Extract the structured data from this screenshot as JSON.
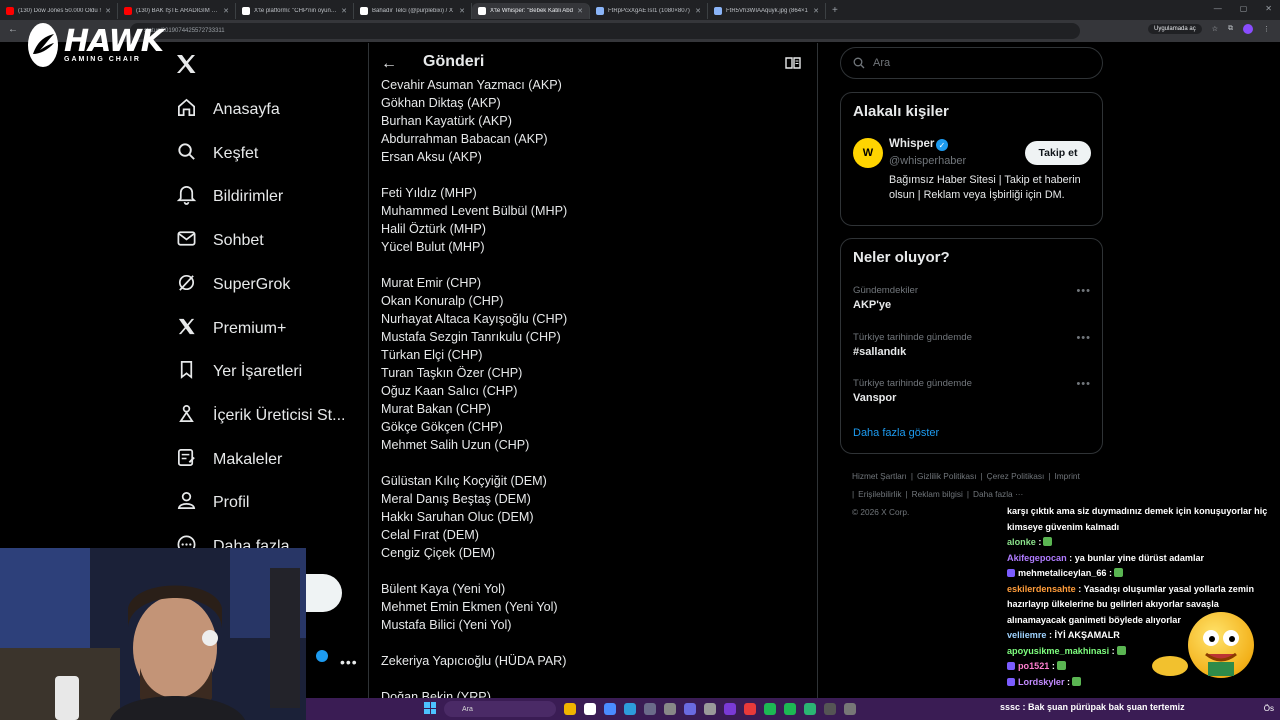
{
  "browser": {
    "tabs": [
      {
        "label": "(130) Dow Jones 50.000 Oldu !",
        "color": "#ff0000"
      },
      {
        "label": "(130) BAK İŞTE ARADIĞIM OYUN",
        "color": "#ff0000"
      },
      {
        "label": "X'te platformi: \"CHP'nin oyunlar",
        "color": "#ffffff"
      },
      {
        "label": "Bahadır Telci (@purplebixi) / X",
        "color": "#ffffff"
      },
      {
        "label": "X'te Whisper: \"Bebek Katili Abd",
        "color": "#ffffff",
        "active": true
      },
      {
        "label": "FtRpPcxXgAETsI1 (1080×807)",
        "color": "#8ab4f8"
      },
      {
        "label": "FtR5Vh3WIAAquyk.jpg (864×1",
        "color": "#8ab4f8"
      }
    ],
    "address": "status/2019074425572733311",
    "open_in_app": "Uygulamada aç"
  },
  "overlay": {
    "brand": "HAWK",
    "brand_sub": "GAMING CHAIR"
  },
  "nav": {
    "items": [
      {
        "label": "Anasayfa",
        "icon": "home-icon"
      },
      {
        "label": "Keşfet",
        "icon": "search-icon"
      },
      {
        "label": "Bildirimler",
        "icon": "bell-icon"
      },
      {
        "label": "Sohbet",
        "icon": "mail-icon"
      },
      {
        "label": "SuperGrok",
        "icon": "grok-icon"
      },
      {
        "label": "Premium+",
        "icon": "x-icon"
      },
      {
        "label": "Yer İşaretleri",
        "icon": "bookmark-icon"
      },
      {
        "label": "İçerik Üreticisi St...",
        "icon": "creator-icon"
      },
      {
        "label": "Makaleler",
        "icon": "article-icon"
      },
      {
        "label": "Profil",
        "icon": "person-icon"
      },
      {
        "label": "Daha fazla",
        "icon": "more-icon"
      }
    ]
  },
  "post": {
    "header_title": "Gönderi",
    "lines": [
      "Cevahir Asuman Yazmacı (AKP)",
      "Gökhan Diktaş (AKP)",
      "Burhan Kayatürk (AKP)",
      "Abdurrahman Babacan (AKP)",
      "Ersan Aksu (AKP)",
      "",
      "Feti Yıldız (MHP)",
      "Muhammed Levent Bülbül (MHP)",
      "Halil Öztürk (MHP)",
      "Yücel Bulut (MHP)",
      "",
      "Murat Emir (CHP)",
      "Okan Konuralp (CHP)",
      "Nurhayat Altaca Kayışoğlu (CHP)",
      "Mustafa Sezgin Tanrıkulu (CHP)",
      "Türkan Elçi (CHP)",
      "Turan Taşkın Özer (CHP)",
      "Oğuz Kaan Salıcı (CHP)",
      "Murat Bakan (CHP)",
      "Gökçe Gökçen (CHP)",
      "Mehmet Salih Uzun (CHP)",
      "",
      "Gülüstan Kılıç Koçyiğit (DEM)",
      "Meral Danış Beştaş (DEM)",
      "Hakkı Saruhan Oluc (DEM)",
      "Celal Fırat (DEM)",
      "Cengiz Çiçek (DEM)",
      "",
      "Bülent Kaya (Yeni Yol)",
      "Mehmet Emin Ekmen (Yeni Yol)",
      "Mustafa Bilici (Yeni Yol)",
      "",
      "Zekeriya Yapıcıoğlu (HÜDA PAR)",
      "",
      "Doğan Bekin (YRP)"
    ]
  },
  "sidebar": {
    "search_placeholder": "Ara",
    "related_title": "Alakalı kişiler",
    "related": {
      "avatar_text": "W",
      "name": "Whisper",
      "handle": "@whisperhaber",
      "follow_label": "Takip et",
      "bio": "Bağımsız Haber Sitesi | Takip et haberin olsun | Reklam veya İşbirliği için DM."
    },
    "trends_title": "Neler oluyor?",
    "trends": [
      {
        "context": "Gündemdekiler",
        "name": "AKP'ye"
      },
      {
        "context": "Türkiye tarihinde gündemde",
        "name": "#sallandık"
      },
      {
        "context": "Türkiye tarihinde gündemde",
        "name": "Vanspor"
      }
    ],
    "show_more": "Daha fazla göster",
    "footer": [
      "Hizmet Şartları",
      "|",
      "Gizlilik Politikası",
      "|",
      "Çerez Politikası",
      "|",
      "Imprint",
      "|",
      "Erişilebilirlik",
      "|",
      "Reklam bilgisi",
      "|",
      "Daha fazla ···",
      "© 2026 X Corp."
    ]
  },
  "chat": {
    "messages": [
      {
        "user": "",
        "text": "karşı çıktık ama siz duymadınız demek için konuşuyorlar hiç kimseye güvenim kalmadı",
        "color": "#ffffff",
        "badge": false
      },
      {
        "user": "alonke",
        "text": ":",
        "color": "#8be28b",
        "badge": false,
        "emote": true
      },
      {
        "user": "Akifegepocan",
        "text": ": ya bunlar yine dürüst adamlar",
        "color": "#b07cff",
        "badge": false
      },
      {
        "user": "mehmetaliceylan_66",
        "text": ":",
        "color": "#ffffff",
        "badge": true,
        "emote": true
      },
      {
        "user": "eskilerdensahte",
        "text": ": Yasadışı oluşumlar yasal yollarla zemin hazırlayıp ülkelerine bu gelirleri akıyorlar savaşla alınamayacak ganimeti böylede alıyorlar",
        "color": "#ff9c3a",
        "badge": false
      },
      {
        "user": "veliiemre",
        "text": ": İYİ AKŞAMALR",
        "color": "#9fd3ff",
        "badge": false
      },
      {
        "user": "apoyusikme_makhinasi",
        "text": ":",
        "color": "#7fff7f",
        "badge": false,
        "emote": true
      },
      {
        "user": "po1521",
        "text": ":",
        "color": "#ff7fd0",
        "badge": true,
        "emote": true
      },
      {
        "user": "Lordskyler",
        "text": ":",
        "color": "#c38bff",
        "badge": true,
        "emote": true
      }
    ]
  },
  "taskbar": {
    "search_label": "Ara",
    "bottom_chat": "sssc : Bak şuan pürüpak bak şuan tertemiz",
    "time": "Ös"
  }
}
